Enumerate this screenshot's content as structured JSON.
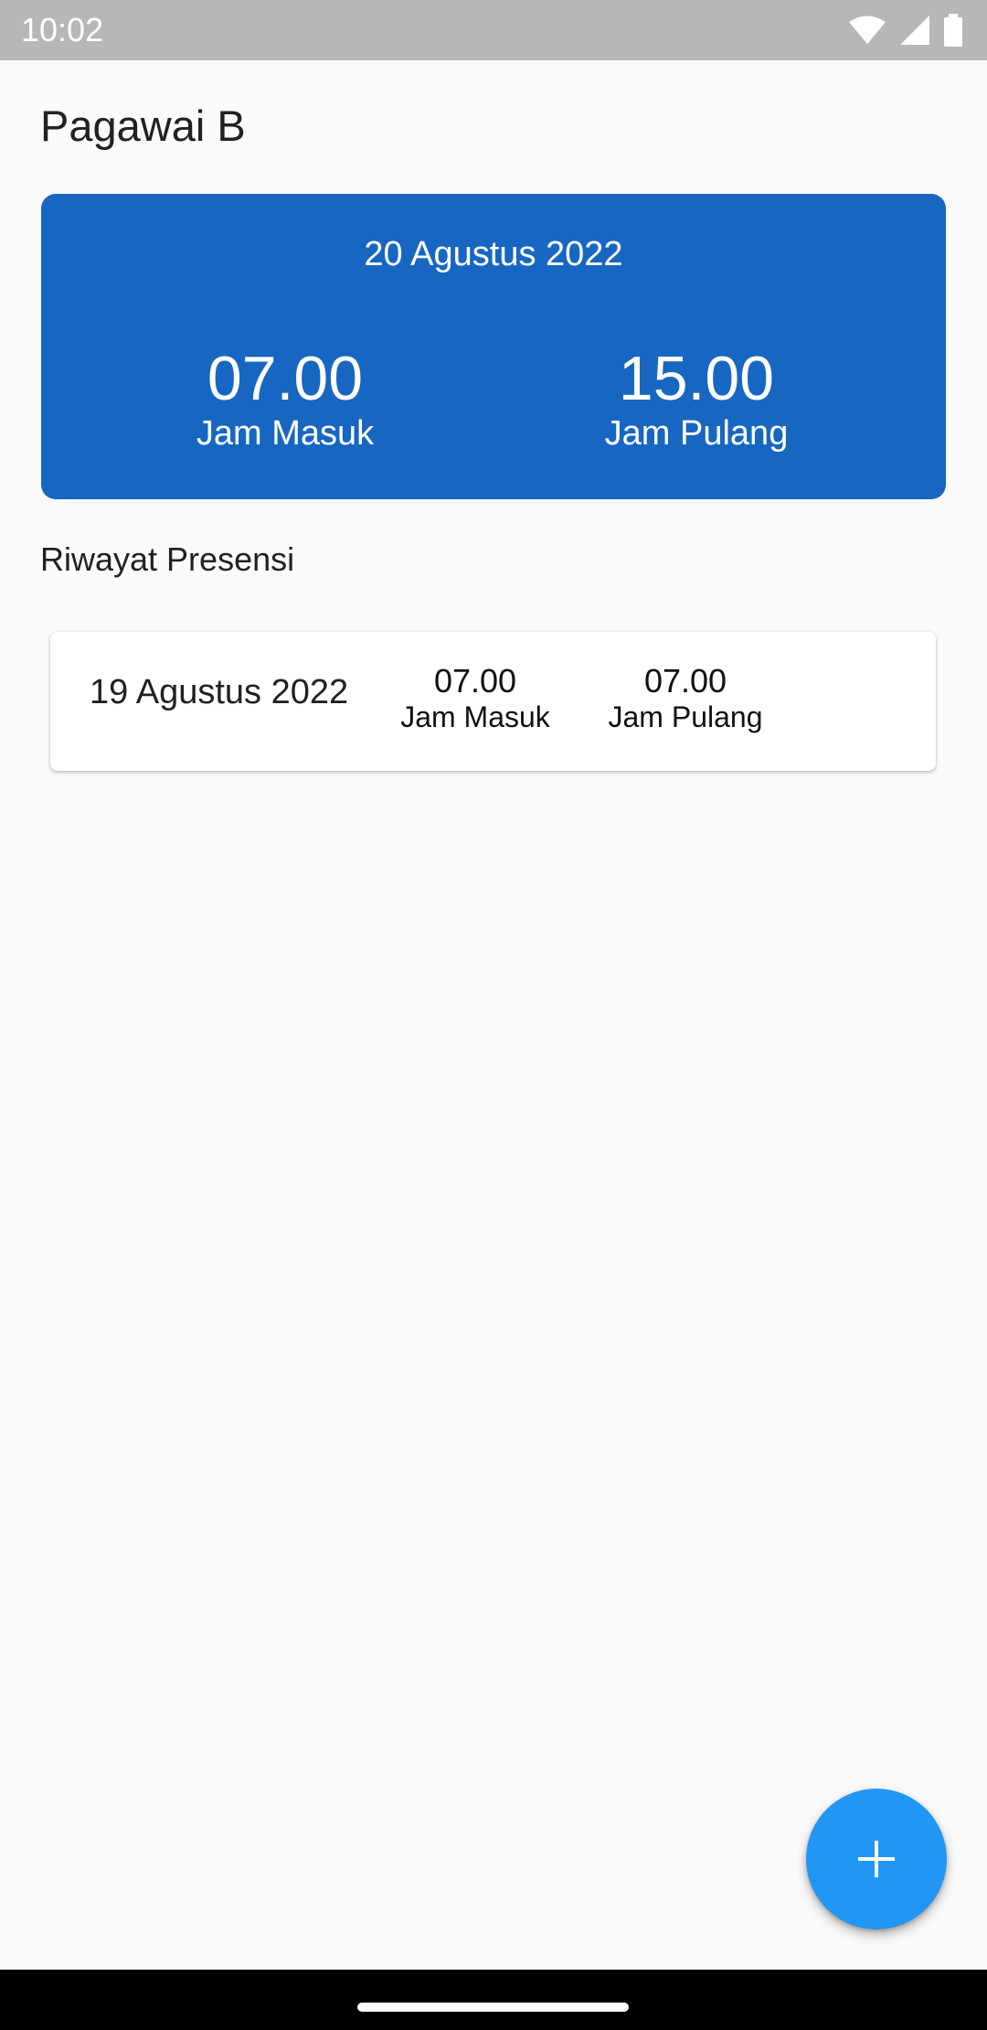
{
  "status_bar": {
    "time": "10:02",
    "icons": [
      "wifi-icon",
      "signal-icon",
      "battery-icon"
    ]
  },
  "page": {
    "title": "Pagawai B"
  },
  "today": {
    "date": "20 Agustus 2022",
    "check_in_time": "07.00",
    "check_in_label": "Jam Masuk",
    "check_out_time": "15.00",
    "check_out_label": "Jam Pulang",
    "color": "#1767c2"
  },
  "history": {
    "title": "Riwayat Presensi",
    "items": [
      {
        "date": "19 Agustus 2022",
        "check_in_time": "07.00",
        "check_in_label": "Jam Masuk",
        "check_out_time": "07.00",
        "check_out_label": "Jam Pulang"
      }
    ]
  },
  "fab": {
    "icon": "plus-icon",
    "color": "#2196f3"
  },
  "nav_bar": {
    "icon": "home-handle"
  }
}
